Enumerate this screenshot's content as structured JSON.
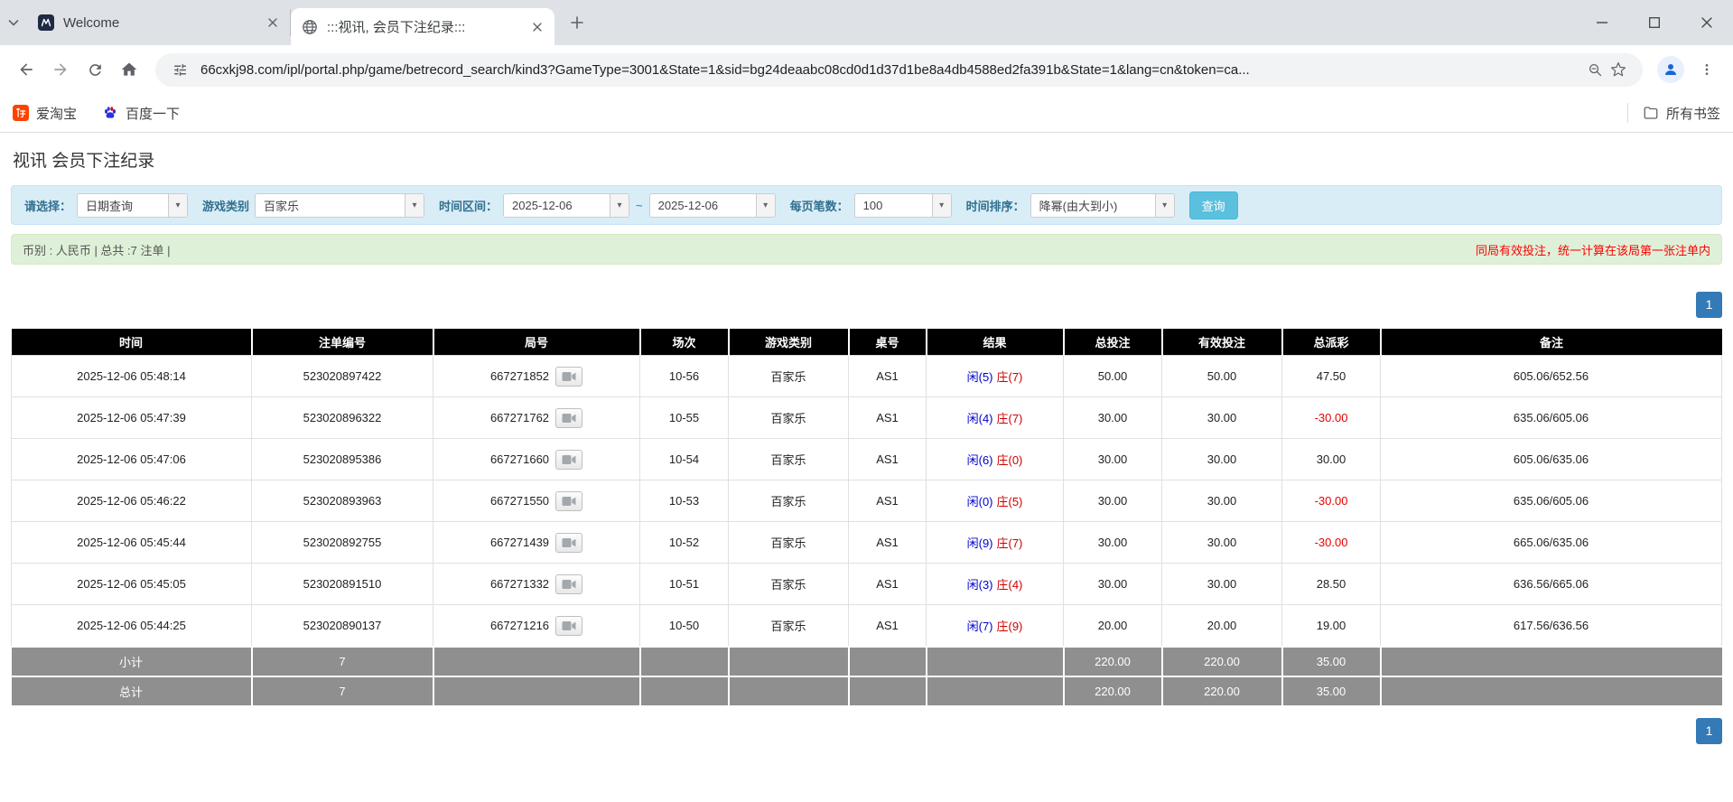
{
  "colors": {
    "accent_blue": "#337ab7",
    "search_button_teal": "#5bc0de",
    "filter_bar_bg": "#d9edf7",
    "summary_bar_bg": "#dff0d8",
    "table_header_bg": "#000000",
    "table_footer_bg": "#8f8f8f",
    "player_blue": "#0000cc",
    "banker_red": "#cc0000",
    "negative_red": "#e60000",
    "notice_red": "#ff0000"
  },
  "browser": {
    "tabs": [
      {
        "title": "Welcome"
      },
      {
        "title": ":::视讯, 会员下注纪录:::"
      }
    ],
    "url": "66cxkj98.com/ipl/portal.php/game/betrecord_search/kind3?GameType=3001&State=1&sid=bg24deaabc08cd0d1d37d1be8a4db4588ed2fa391b&State=1&lang=cn&token=ca...",
    "bookmarks": {
      "item1": "爱淘宝",
      "item2": "百度一下",
      "all_bookmarks": "所有书签"
    }
  },
  "page": {
    "title": "视讯 会员下注纪录",
    "filters": {
      "select_label": "请选择：",
      "select_value": "日期查询",
      "game_type_label": "游戏类别",
      "game_type_value": "百家乐",
      "date_range_label": "时间区间：",
      "date_from": "2025-12-06",
      "date_to": "2025-12-06",
      "range_separator": "~",
      "page_size_label": "每页笔数：",
      "page_size_value": "100",
      "sort_label": "时间排序：",
      "sort_value": "降幂(由大到小)",
      "search_button": "查询",
      "caret": "▾"
    },
    "summary": {
      "left": "币别 : 人民币 | 总共 :7 注单 |",
      "right": "同局有效投注，统一计算在该局第一张注单内"
    },
    "pagination": {
      "page": "1"
    },
    "table": {
      "headers": [
        "时间",
        "注单编号",
        "局号",
        "场次",
        "游戏类别",
        "桌号",
        "结果",
        "总投注",
        "有效投注",
        "总派彩",
        "备注"
      ],
      "rows": [
        {
          "time": "2025-12-06 05:48:14",
          "bet_id": "523020897422",
          "round": "667271852",
          "session": "10-56",
          "game": "百家乐",
          "table_no": "AS1",
          "result_player": "闲(5)",
          "result_banker": "庄(7)",
          "total_bet": "50.00",
          "valid_bet": "50.00",
          "payout": "47.50",
          "note": "605.06/652.56"
        },
        {
          "time": "2025-12-06 05:47:39",
          "bet_id": "523020896322",
          "round": "667271762",
          "session": "10-55",
          "game": "百家乐",
          "table_no": "AS1",
          "result_player": "闲(4)",
          "result_banker": "庄(7)",
          "total_bet": "30.00",
          "valid_bet": "30.00",
          "payout": "-30.00",
          "note": "635.06/605.06"
        },
        {
          "time": "2025-12-06 05:47:06",
          "bet_id": "523020895386",
          "round": "667271660",
          "session": "10-54",
          "game": "百家乐",
          "table_no": "AS1",
          "result_player": "闲(6)",
          "result_banker": "庄(0)",
          "total_bet": "30.00",
          "valid_bet": "30.00",
          "payout": "30.00",
          "note": "605.06/635.06"
        },
        {
          "time": "2025-12-06 05:46:22",
          "bet_id": "523020893963",
          "round": "667271550",
          "session": "10-53",
          "game": "百家乐",
          "table_no": "AS1",
          "result_player": "闲(0)",
          "result_banker": "庄(5)",
          "total_bet": "30.00",
          "valid_bet": "30.00",
          "payout": "-30.00",
          "note": "635.06/605.06"
        },
        {
          "time": "2025-12-06 05:45:44",
          "bet_id": "523020892755",
          "round": "667271439",
          "session": "10-52",
          "game": "百家乐",
          "table_no": "AS1",
          "result_player": "闲(9)",
          "result_banker": "庄(7)",
          "total_bet": "30.00",
          "valid_bet": "30.00",
          "payout": "-30.00",
          "note": "665.06/635.06"
        },
        {
          "time": "2025-12-06 05:45:05",
          "bet_id": "523020891510",
          "round": "667271332",
          "session": "10-51",
          "game": "百家乐",
          "table_no": "AS1",
          "result_player": "闲(3)",
          "result_banker": "庄(4)",
          "total_bet": "30.00",
          "valid_bet": "30.00",
          "payout": "28.50",
          "note": "636.56/665.06"
        },
        {
          "time": "2025-12-06 05:44:25",
          "bet_id": "523020890137",
          "round": "667271216",
          "session": "10-50",
          "game": "百家乐",
          "table_no": "AS1",
          "result_player": "闲(7)",
          "result_banker": "庄(9)",
          "total_bet": "20.00",
          "valid_bet": "20.00",
          "payout": "19.00",
          "note": "617.56/636.56"
        }
      ],
      "subtotal": {
        "label": "小计",
        "count": "7",
        "total_bet": "220.00",
        "valid_bet": "220.00",
        "payout": "35.00"
      },
      "total": {
        "label": "总计",
        "count": "7",
        "total_bet": "220.00",
        "valid_bet": "220.00",
        "payout": "35.00"
      }
    }
  }
}
